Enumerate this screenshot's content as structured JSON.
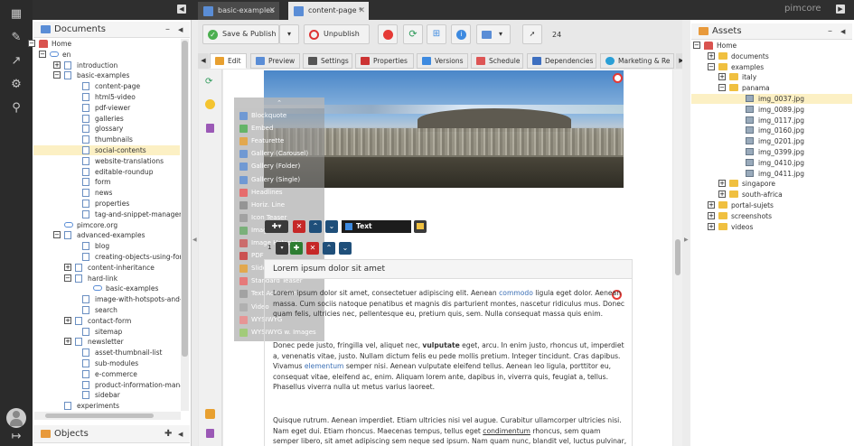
{
  "tabs": [
    {
      "label": "basic-examples",
      "close": "✕"
    },
    {
      "label": "content-page *",
      "close": "✕"
    }
  ],
  "brand": "pimcore",
  "documents_panel": {
    "title": "Documents",
    "items": [
      {
        "label": "Home"
      },
      {
        "label": "en"
      },
      {
        "label": "introduction"
      },
      {
        "label": "basic-examples"
      },
      {
        "label": "content-page"
      },
      {
        "label": "html5-video"
      },
      {
        "label": "pdf-viewer"
      },
      {
        "label": "galleries"
      },
      {
        "label": "glossary"
      },
      {
        "label": "thumbnails"
      },
      {
        "label": "social-contents"
      },
      {
        "label": "website-translations"
      },
      {
        "label": "editable-roundup"
      },
      {
        "label": "form"
      },
      {
        "label": "news"
      },
      {
        "label": "properties"
      },
      {
        "label": "tag-and-snippet-managem"
      },
      {
        "label": "pimcore.org"
      },
      {
        "label": "advanced-examples"
      },
      {
        "label": "blog"
      },
      {
        "label": "creating-objects-using-form"
      },
      {
        "label": "content-inheritance"
      },
      {
        "label": "hard-link"
      },
      {
        "label": "basic-examples"
      },
      {
        "label": "image-with-hotspots-and-r"
      },
      {
        "label": "search"
      },
      {
        "label": "contact-form"
      },
      {
        "label": "sitemap"
      },
      {
        "label": "newsletter"
      },
      {
        "label": "asset-thumbnail-list"
      },
      {
        "label": "sub-modules"
      },
      {
        "label": "e-commerce"
      },
      {
        "label": "product-information-mana"
      },
      {
        "label": "sidebar"
      },
      {
        "label": "experiments"
      }
    ]
  },
  "objects_panel": {
    "title": "Objects"
  },
  "toolbar": {
    "save_publish": "Save & Publish",
    "unpublish": "Unpublish",
    "doc_id": "24"
  },
  "subtabs": [
    "Edit",
    "Preview",
    "Settings",
    "Properties",
    "Versions",
    "Schedule",
    "Dependencies",
    "Marketing & Re"
  ],
  "insert_menu": [
    "Blockquote",
    "Embed",
    "Featurette",
    "Gallery (Carousel)",
    "Gallery (Folder)",
    "Gallery (Single)",
    "Headlines",
    "Horiz. Line",
    "Icon Teaser",
    "Image",
    "Image Hotspots",
    "PDF",
    "Slider (Tabs/Text)",
    "Standard Teaser",
    "Text Accordion",
    "Video",
    "WYSIWYG",
    "WYSIWYG w. Images"
  ],
  "editor": {
    "block_label": "Text Accordion",
    "block_index": "1",
    "accordion_title": "Lorem ipsum dolor sit amet",
    "p1": {
      "a": "Lorem ipsum dolor sit amet, consectetuer adipiscing elit. Aenean ",
      "link": "commodo",
      "b": " ligula eget dolor. Aenean massa. Cum sociis natoque penatibus et magnis dis parturient montes, nascetur ridiculus mus. Donec quam felis, ultricies nec, pellentesque eu, pretium quis, sem. Nulla consequat massa quis enim."
    },
    "p2": {
      "a": "Donec pede justo, fringilla vel, aliquet nec, ",
      "bold": "vulputate",
      "b": " eget, arcu. In enim justo, rhoncus ut, imperdiet a, venenatis vitae, justo. Nullam dictum felis eu pede mollis pretium. Integer tincidunt. Cras dapibus. Vivamus ",
      "link": "elementum",
      "c": " semper nisi. Aenean vulputate eleifend tellus. Aenean leo ligula, porttitor eu, consequat vitae, eleifend ac, enim. Aliquam lorem ante, dapibus in, viverra quis, feugiat a, tellus. Phasellus viverra nulla ut metus varius laoreet."
    },
    "p3": {
      "a": "Quisque rutrum. Aenean imperdiet. Etiam ultricies nisi vel augue. Curabitur ullamcorper ultricies nisi. Nam eget dui. Etiam rhoncus. Maecenas tempus, tellus eget ",
      "u": "condimentum",
      "b": " rhoncus, sem quam semper libero, sit amet adipiscing sem neque sed ipsum. Nam quam nunc, blandit vel, luctus pulvinar, hendrerit id,"
    }
  },
  "assets_panel": {
    "title": "Assets",
    "items": [
      {
        "label": "Home"
      },
      {
        "label": "documents"
      },
      {
        "label": "examples"
      },
      {
        "label": "italy"
      },
      {
        "label": "panama"
      },
      {
        "label": "img_0037.jpg"
      },
      {
        "label": "img_0089.jpg"
      },
      {
        "label": "img_0117.jpg"
      },
      {
        "label": "img_0160.jpg"
      },
      {
        "label": "img_0201.jpg"
      },
      {
        "label": "img_0399.jpg"
      },
      {
        "label": "img_0410.jpg"
      },
      {
        "label": "img_0411.jpg"
      },
      {
        "label": "singapore"
      },
      {
        "label": "south-africa"
      },
      {
        "label": "portal-sujets"
      },
      {
        "label": "screenshots"
      },
      {
        "label": "videos"
      }
    ]
  }
}
